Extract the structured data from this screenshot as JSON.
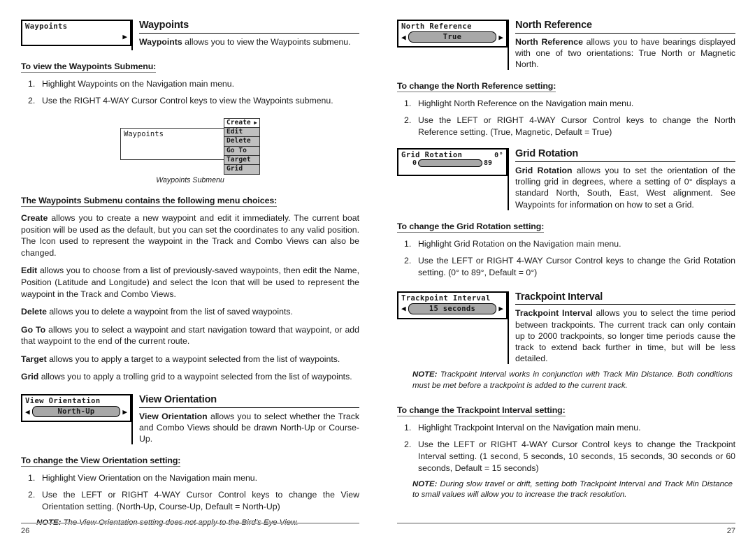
{
  "left_page": {
    "page_number": "26",
    "waypoints": {
      "widget": {
        "label": "Waypoints",
        "arrow_right": "▶"
      },
      "title": "Waypoints",
      "lead": "Waypoints allows you to view the Waypoints submenu.",
      "lead_bold": "Waypoints",
      "lead_rest": " allows you to view the Waypoints submenu.",
      "subhead": "To view the Waypoints Submenu:",
      "steps": [
        "Highlight Waypoints on the Navigation main menu.",
        "Use the RIGHT 4-WAY Cursor Control keys to view the Waypoints submenu."
      ],
      "figure": {
        "box_label": "Waypoints",
        "menu_items": [
          {
            "label": "Create",
            "arrow": "▶",
            "selected": true
          },
          {
            "label": "Edit",
            "arrow": "",
            "selected": false
          },
          {
            "label": "Delete",
            "arrow": "",
            "selected": false
          },
          {
            "label": "Go To",
            "arrow": "",
            "selected": false
          },
          {
            "label": "Target",
            "arrow": "",
            "selected": false
          },
          {
            "label": "Grid",
            "arrow": "",
            "selected": false
          }
        ],
        "caption": "Waypoints Submenu"
      },
      "choices_subhead": "The Waypoints Submenu contains the following menu choices:",
      "choices": [
        {
          "term": "Create",
          "text": " allows you to create a new waypoint and edit it immediately.  The current boat position will be used as the default, but you can set the coordinates to any valid position. The Icon used to represent the waypoint in the Track and Combo Views can also be changed."
        },
        {
          "term": "Edit",
          "text": " allows you to choose from a list of previously-saved waypoints, then edit the Name, Position (Latitude and Longitude) and select the Icon that will be used to represent the waypoint in the Track and Combo Views."
        },
        {
          "term": "Delete",
          "text": " allows you to delete a waypoint from the list of saved waypoints."
        },
        {
          "term": "Go To",
          "text": " allows you to select a waypoint and start navigation toward that waypoint, or add that waypoint to the end of the current route."
        },
        {
          "term": "Target",
          "text": " allows you to apply a target to a waypoint selected from the list of waypoints."
        },
        {
          "term": "Grid",
          "text": " allows you to apply a trolling grid to a waypoint selected from the list of waypoints."
        }
      ]
    },
    "view_orientation": {
      "widget": {
        "label": "View Orientation",
        "value": "North-Up",
        "arrow_left": "◀",
        "arrow_right": "▶"
      },
      "title": "View Orientation",
      "lead_bold": "View Orientation",
      "lead_rest": " allows you to select whether the Track and Combo Views should be drawn North-Up or Course-Up.",
      "subhead": "To change the View Orientation setting:",
      "steps": [
        "Highlight View Orientation on the Navigation main menu.",
        "Use the LEFT or RIGHT 4-WAY Cursor Control keys to change the View Orientation setting. (North-Up, Course-Up, Default = North-Up)"
      ],
      "note_label": "NOTE:",
      "note_text": " The View Orientation setting does not apply to the Bird’s Eye View."
    }
  },
  "right_page": {
    "page_number": "27",
    "north_reference": {
      "widget": {
        "label": "North Reference",
        "value": "True",
        "arrow_left": "◀",
        "arrow_right": "▶"
      },
      "title": "North Reference",
      "lead_bold": "North Reference",
      "lead_rest": " allows you to have bearings displayed with one of two orientations: True North or Magnetic North.",
      "subhead": "To change the North Reference setting:",
      "steps": [
        "Highlight North Reference on the Navigation main menu.",
        "Use the LEFT or RIGHT 4-WAY Cursor Control keys to change the North Reference setting. (True, Magnetic, Default = True)"
      ]
    },
    "grid_rotation": {
      "widget": {
        "label": "Grid Rotation",
        "value_right": "0°",
        "slider_min": "0",
        "slider_max": "89"
      },
      "title": "Grid Rotation",
      "lead_bold": "Grid Rotation",
      "lead_rest": " allows you to set the orientation of the trolling grid in degrees, where a setting of 0° displays a standard North, South, East, West alignment. See Waypoints for information on how to set a Grid.",
      "subhead": "To change the Grid Rotation setting:",
      "steps": [
        "Highlight Grid Rotation on the Navigation main menu.",
        "Use the LEFT or RIGHT 4-WAY Cursor Control keys to change the Grid Rotation setting. (0° to 89°, Default = 0°)"
      ]
    },
    "trackpoint_interval": {
      "widget": {
        "label": "Trackpoint Interval",
        "value": "15 seconds",
        "arrow_left": "◀",
        "arrow_right": "▶"
      },
      "title": "Trackpoint Interval",
      "lead_bold": "Trackpoint Interval",
      "lead_rest": " allows you to select the time period between trackpoints.  The current track can only contain up to 2000 trackpoints, so longer time periods cause the track to extend back further in time, but will be less detailed.",
      "note1_label": "NOTE:",
      "note1_text": " Trackpoint Interval works in conjunction with Track Min Distance.  Both conditions must be met before a trackpoint is added to the current track.",
      "subhead": "To change the Trackpoint Interval setting:",
      "steps": [
        "Highlight Trackpoint Interval on the Navigation main menu.",
        "Use the LEFT or RIGHT 4-WAY Cursor Control keys to change the Trackpoint Interval setting. (1 second, 5 seconds, 10 seconds, 15 seconds, 30 seconds or 60 seconds, Default = 15 seconds)"
      ],
      "note2_label": "NOTE:",
      "note2_text": " During slow travel or drift, setting both Trackpoint Interval and Track Min Distance to small values will allow you to increase the track resolution."
    }
  }
}
